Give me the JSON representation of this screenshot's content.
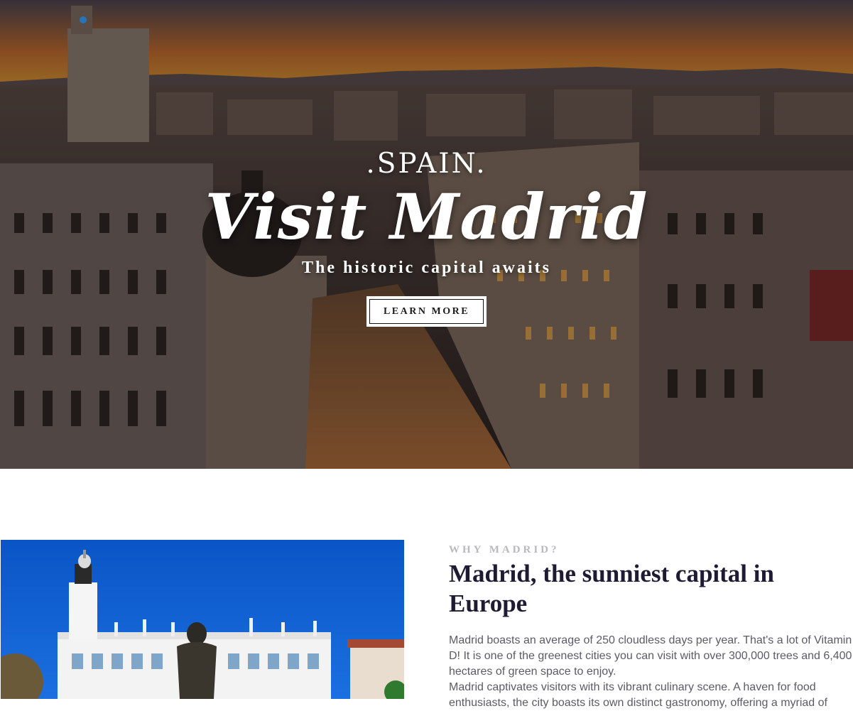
{
  "hero": {
    "eyebrow": ".SPAIN.",
    "title": "Visit Madrid",
    "tagline": "The historic capital awaits",
    "cta_label": "LEARN MORE"
  },
  "about": {
    "kicker": "WHY MADRID?",
    "title": "Madrid, the sunniest capital in Europe",
    "paragraphs": [
      "Madrid boasts an average of 250 cloudless days per year. That's a lot of Vitamin D! It is one of the greenest cities you can visit with over 300,000 trees and 6,400 hectares of green space to enjoy.",
      "Madrid captivates visitors with its vibrant culinary scene. A haven for food enthusiasts, the city boasts its own distinct gastronomy, offering a myriad of"
    ]
  },
  "colors": {
    "heading": "#1f1b33",
    "kicker": "#b9b9bd",
    "body_text": "#5b5b66",
    "sky_blue": "#0a4fbf"
  }
}
